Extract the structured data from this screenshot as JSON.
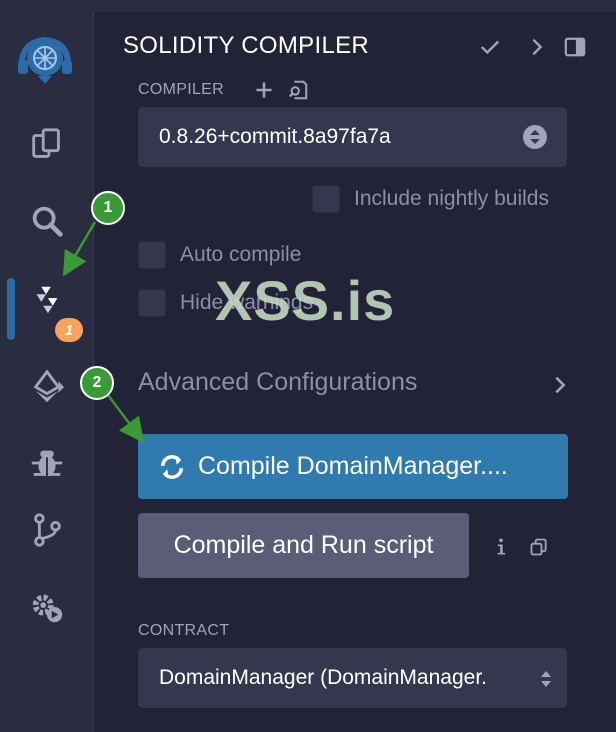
{
  "sidebar": {
    "badge": "1",
    "icons": [
      "remix-logo",
      "file-explorer-icon",
      "search-icon",
      "solidity-compiler-icon",
      "deploy-run-icon",
      "debugger-icon",
      "git-icon",
      "plugin-settings-icon"
    ]
  },
  "header": {
    "title": "SOLIDITY COMPILER"
  },
  "compiler": {
    "label": "COMPILER",
    "version": "0.8.26+commit.8a97fa7a",
    "nightly_label": "Include nightly builds",
    "auto_compile_label": "Auto compile",
    "hide_warnings_label": "Hide warnings"
  },
  "advanced": {
    "label": "Advanced Configurations"
  },
  "buttons": {
    "compile_label": "Compile DomainManager....",
    "run_script_label": "Compile and Run script"
  },
  "contract": {
    "label": "CONTRACT",
    "selected": "DomainManager (DomainManager."
  },
  "overlay": {
    "watermark": "XSS.is",
    "step1": "1",
    "step2": "2"
  },
  "colors": {
    "accent": "#2f7aaf",
    "step_green": "#3a9a35",
    "badge_orange": "#f5a35d"
  }
}
